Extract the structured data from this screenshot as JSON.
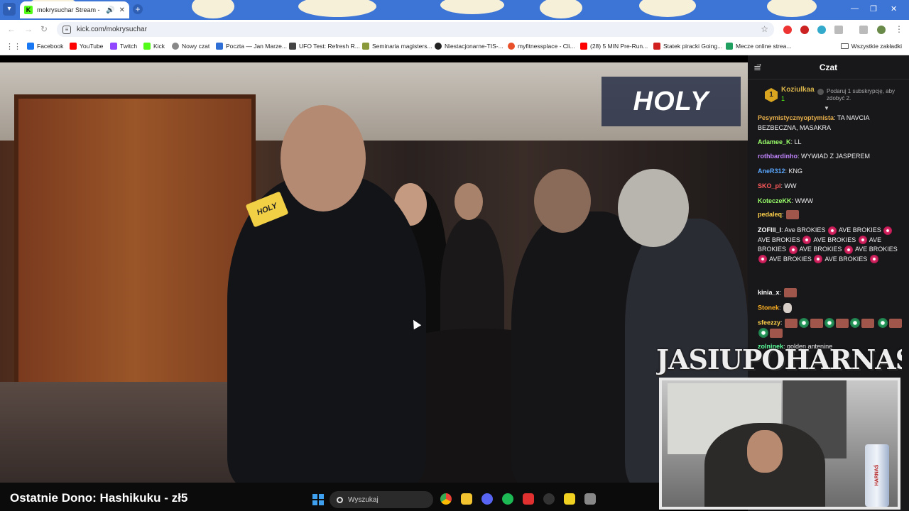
{
  "browser": {
    "tab": {
      "title": "mokrysuchar Stream - Wat",
      "favicon": "K"
    },
    "url": "kick.com/mokrysuchar",
    "bookmarks": [
      {
        "label": "Facebook",
        "color": "#1877f2"
      },
      {
        "label": "YouTube",
        "color": "#ff0000"
      },
      {
        "label": "Twitch",
        "color": "#9146ff"
      },
      {
        "label": "Kick",
        "color": "#53fc18"
      },
      {
        "label": "Nowy czat",
        "color": "#888888"
      },
      {
        "label": "Poczta — Jan Marze...",
        "color": "#2f6fd6"
      },
      {
        "label": "UFO Test: Refresh R...",
        "color": "#444444"
      },
      {
        "label": "Seminaria magisters...",
        "color": "#8a9a3a"
      },
      {
        "label": "Niestacjonarne-TIS-...",
        "color": "#222222"
      },
      {
        "label": "myfitnessplace - Cli...",
        "color": "#e8502a"
      },
      {
        "label": "(28) 5 MIN Pre-Run...",
        "color": "#ff0000"
      },
      {
        "label": "Statek piracki Going...",
        "color": "#d02020"
      },
      {
        "label": "Mecze online strea...",
        "color": "#20a060"
      }
    ],
    "all_bookmarks": "Wszystkie zakładki"
  },
  "video": {
    "overlay_logo": "HOLY",
    "mic_label": "HOLY",
    "cam_label": "JASIUPOHARNASIU",
    "can_label": "HARNAŚ",
    "ticker": "Ostatnie Dono: Hashikuku - zł5"
  },
  "chat": {
    "title": "Czat",
    "pinned": {
      "rank": "1",
      "name": "Koziulkaa",
      "count": "1",
      "gift_text": "Podaruj 1 subskrypcję, aby zdobyć 2."
    },
    "messages": [
      {
        "user": "Pesymistycznyoptymista",
        "color": "#e8b04a",
        "text": ": TA NAVCIA BEZBECZNA, MASAKRA"
      },
      {
        "user": "Adamee_K",
        "color": "#9aff6a",
        "text": ": LL"
      },
      {
        "user": "rothbardinho",
        "color": "#c084fc",
        "text": ": WYWIAD Z JASPEREM"
      },
      {
        "user": "AneR312",
        "color": "#5aa8ff",
        "text": ": KNG"
      },
      {
        "user": "SKO_pl",
        "color": "#ff5a5a",
        "text": ": WW"
      },
      {
        "user": "KoteczeKK",
        "color": "#9aff6a",
        "text": ": WWW"
      },
      {
        "user": "pedaleq",
        "color": "#ffd24a",
        "text": ":"
      },
      {
        "user": "ZOFIII_I",
        "color": "#ffffff",
        "text": ": Ave BROKIES",
        "repeat": "AVE BROKIES"
      },
      {
        "user": "kinia_x",
        "color": "#ffffff",
        "text": ":"
      },
      {
        "user": "Stonek",
        "color": "#ffb020",
        "text": ":"
      },
      {
        "user": "sfeezzy",
        "color": "#ffd24a",
        "text": ":"
      },
      {
        "user": "zolninek",
        "color": "#5aff9a",
        "text": ": golden antenine"
      }
    ]
  },
  "taskbar": {
    "search_placeholder": "Wyszukaj"
  }
}
